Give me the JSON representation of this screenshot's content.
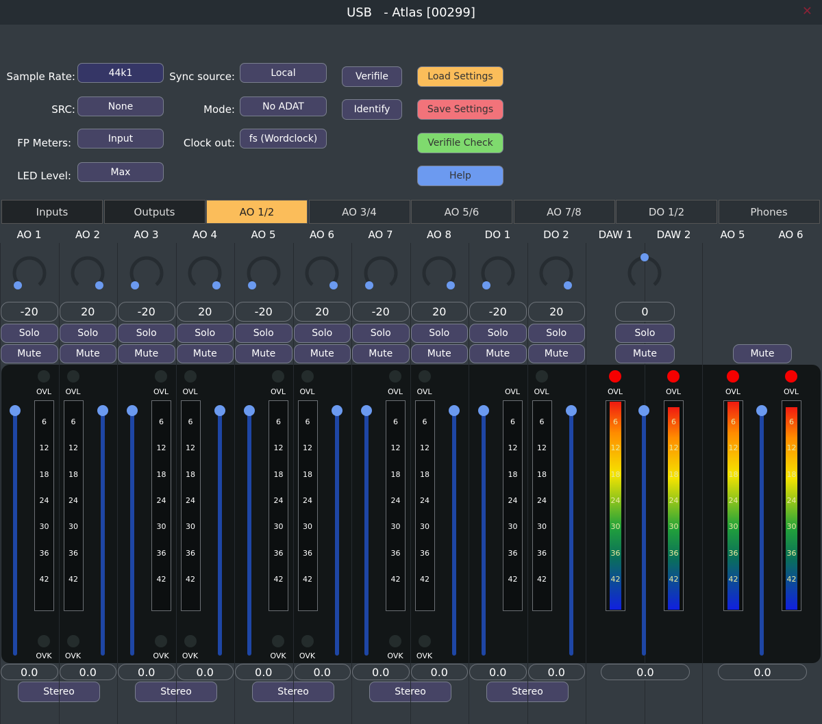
{
  "window": {
    "title": "USB   - Atlas [00299]",
    "close": "✕"
  },
  "settings": {
    "sample_rate": {
      "label": "Sample Rate:",
      "value": "44k1"
    },
    "src": {
      "label": "SRC:",
      "value": "None"
    },
    "fp_meters": {
      "label": "FP Meters:",
      "value": "Input"
    },
    "led_level": {
      "label": "LED Level:",
      "value": "Max"
    },
    "sync_source": {
      "label": "Sync source:",
      "value": "Local"
    },
    "mode": {
      "label": "Mode:",
      "value": "No ADAT"
    },
    "clock_out": {
      "label": "Clock out:",
      "value": "fs (Wordclock)"
    },
    "verifile": "Verifile",
    "identify": "Identify",
    "load": "Load Settings",
    "save": "Save Settings",
    "check": "Verifile Check",
    "help": "Help"
  },
  "colors": {
    "load": "#fbbd5a",
    "save": "#f2737a",
    "check": "#7fda6e",
    "help": "#6c9af0",
    "accent": "#fbbd5a",
    "fader": "#1e46a5",
    "thumb": "#6b9af0",
    "ovl_on": "#f50000"
  },
  "tabs": [
    "Inputs",
    "Outputs",
    "AO 1/2",
    "AO 3/4",
    "AO 5/6",
    "AO 7/8",
    "DO 1/2",
    "Phones"
  ],
  "active_tab": "AO 1/2",
  "scale": [
    "6",
    "12",
    "18",
    "24",
    "30",
    "36",
    "42"
  ],
  "ovl": "OVL",
  "ovk": "OVK",
  "solo": "Solo",
  "mute": "Mute",
  "stereo": "Stereo",
  "mono_channels": [
    {
      "name": "AO 1",
      "pan": "-20",
      "level": "0.0"
    },
    {
      "name": "AO 2",
      "pan": "20",
      "level": "0.0"
    },
    {
      "name": "AO 3",
      "pan": "-20",
      "level": "0.0"
    },
    {
      "name": "AO 4",
      "pan": "20",
      "level": "0.0"
    },
    {
      "name": "AO 5",
      "pan": "-20",
      "level": "0.0"
    },
    {
      "name": "AO 6",
      "pan": "20",
      "level": "0.0"
    },
    {
      "name": "AO 7",
      "pan": "-20",
      "level": "0.0"
    },
    {
      "name": "AO 8",
      "pan": "20",
      "level": "0.0"
    },
    {
      "name": "DO 1",
      "pan": "-20",
      "level": "0.0"
    },
    {
      "name": "DO 2",
      "pan": "20",
      "level": "0.0"
    }
  ],
  "daw": {
    "names": [
      "DAW 1",
      "DAW 2"
    ],
    "pan": "0",
    "level": "0.0"
  },
  "phones": {
    "names": [
      "AO 5",
      "AO 6"
    ],
    "level": "0.0"
  }
}
